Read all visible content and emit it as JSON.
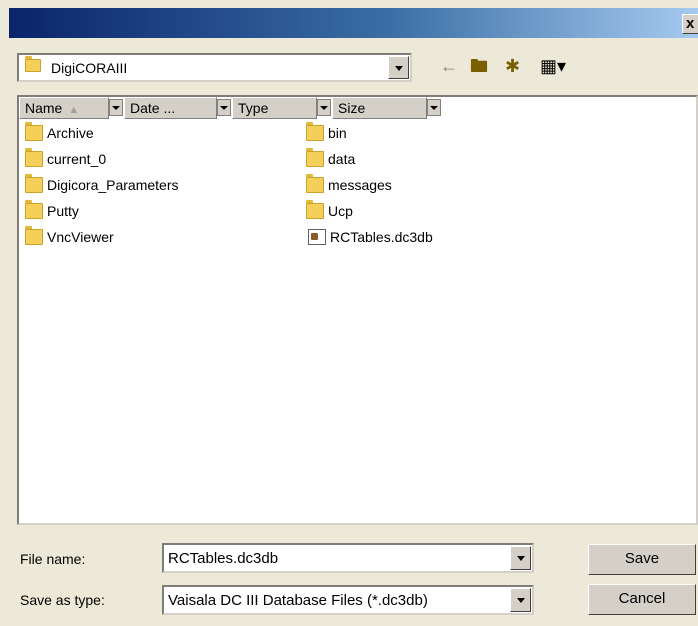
{
  "window": {
    "title": "",
    "close_label": "x"
  },
  "toolbar": {
    "look_in_value": "DigiCORAIII",
    "icons": [
      "back-arrow-icon",
      "up-folder-icon",
      "new-folder-icon",
      "view-menu-icon"
    ]
  },
  "columns": [
    {
      "label": "Name"
    },
    {
      "label": "Date ..."
    },
    {
      "label": "Type"
    },
    {
      "label": "Size"
    }
  ],
  "files_left": [
    {
      "name": "Archive",
      "icon": "folder-icon"
    },
    {
      "name": "current_0",
      "icon": "folder-icon"
    },
    {
      "name": "Digicora_Parameters",
      "icon": "folder-icon"
    },
    {
      "name": "Putty",
      "icon": "folder-icon"
    },
    {
      "name": "VncViewer",
      "icon": "folder-icon"
    }
  ],
  "files_right": [
    {
      "name": "bin",
      "icon": "folder-icon"
    },
    {
      "name": "data",
      "icon": "folder-icon"
    },
    {
      "name": "messages",
      "icon": "folder-icon"
    },
    {
      "name": "Ucp",
      "icon": "folder-icon"
    },
    {
      "name": "RCTables.dc3db",
      "icon": "database-file-icon"
    }
  ],
  "form": {
    "filename_label": "File name:",
    "filename_value": "RCTables.dc3db",
    "savetype_label": "Save as type:",
    "savetype_value": "Vaisala DC III Database Files (*.dc3db)",
    "save_label": "Save",
    "cancel_label": "Cancel"
  }
}
